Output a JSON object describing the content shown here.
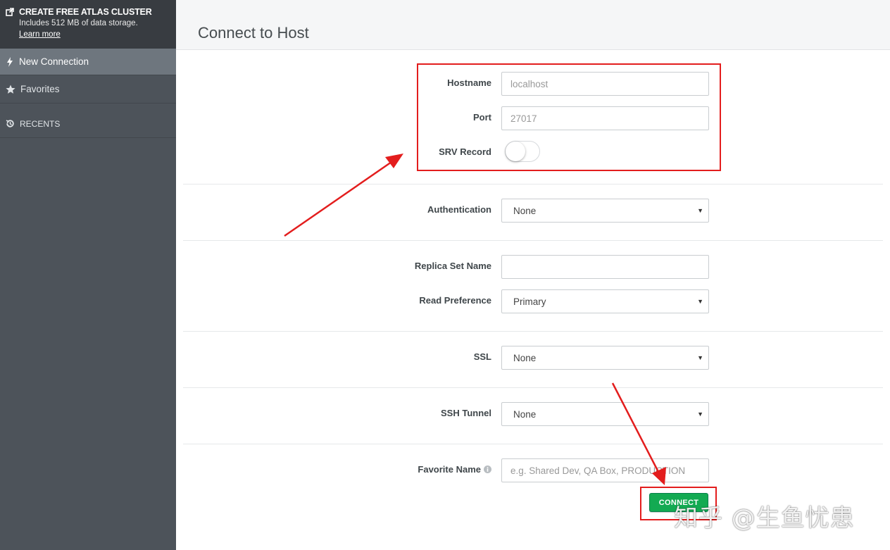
{
  "sidebar": {
    "atlas": {
      "title": "CREATE FREE ATLAS CLUSTER",
      "subtitle": "Includes 512 MB of data storage.",
      "link": "Learn more"
    },
    "items": [
      {
        "label": "New Connection",
        "icon": "bolt-icon",
        "active": true
      },
      {
        "label": "Favorites",
        "icon": "star-icon"
      },
      {
        "label": "RECENTS",
        "icon": "history-icon"
      }
    ]
  },
  "header": {
    "title": "Connect to Host"
  },
  "form": {
    "hostname": {
      "label": "Hostname",
      "placeholder": "localhost"
    },
    "port": {
      "label": "Port",
      "placeholder": "27017"
    },
    "srv_record": {
      "label": "SRV Record",
      "enabled": false
    },
    "authentication": {
      "label": "Authentication",
      "value": "None"
    },
    "replica_set_name": {
      "label": "Replica Set Name",
      "value": ""
    },
    "read_preference": {
      "label": "Read Preference",
      "value": "Primary"
    },
    "ssl": {
      "label": "SSL",
      "value": "None"
    },
    "ssh_tunnel": {
      "label": "SSH Tunnel",
      "value": "None"
    },
    "favorite_name": {
      "label": "Favorite Name",
      "placeholder": "e.g. Shared Dev, QA Box, PRODUCTION"
    },
    "connect_label": "CONNECT"
  },
  "colors": {
    "accent_green": "#13aa52",
    "annotation_red": "#e31d1d",
    "sidebar_bg": "#4d535a",
    "sidebar_active": "#6e767e"
  },
  "watermark": "知乎 @生鱼忧患"
}
